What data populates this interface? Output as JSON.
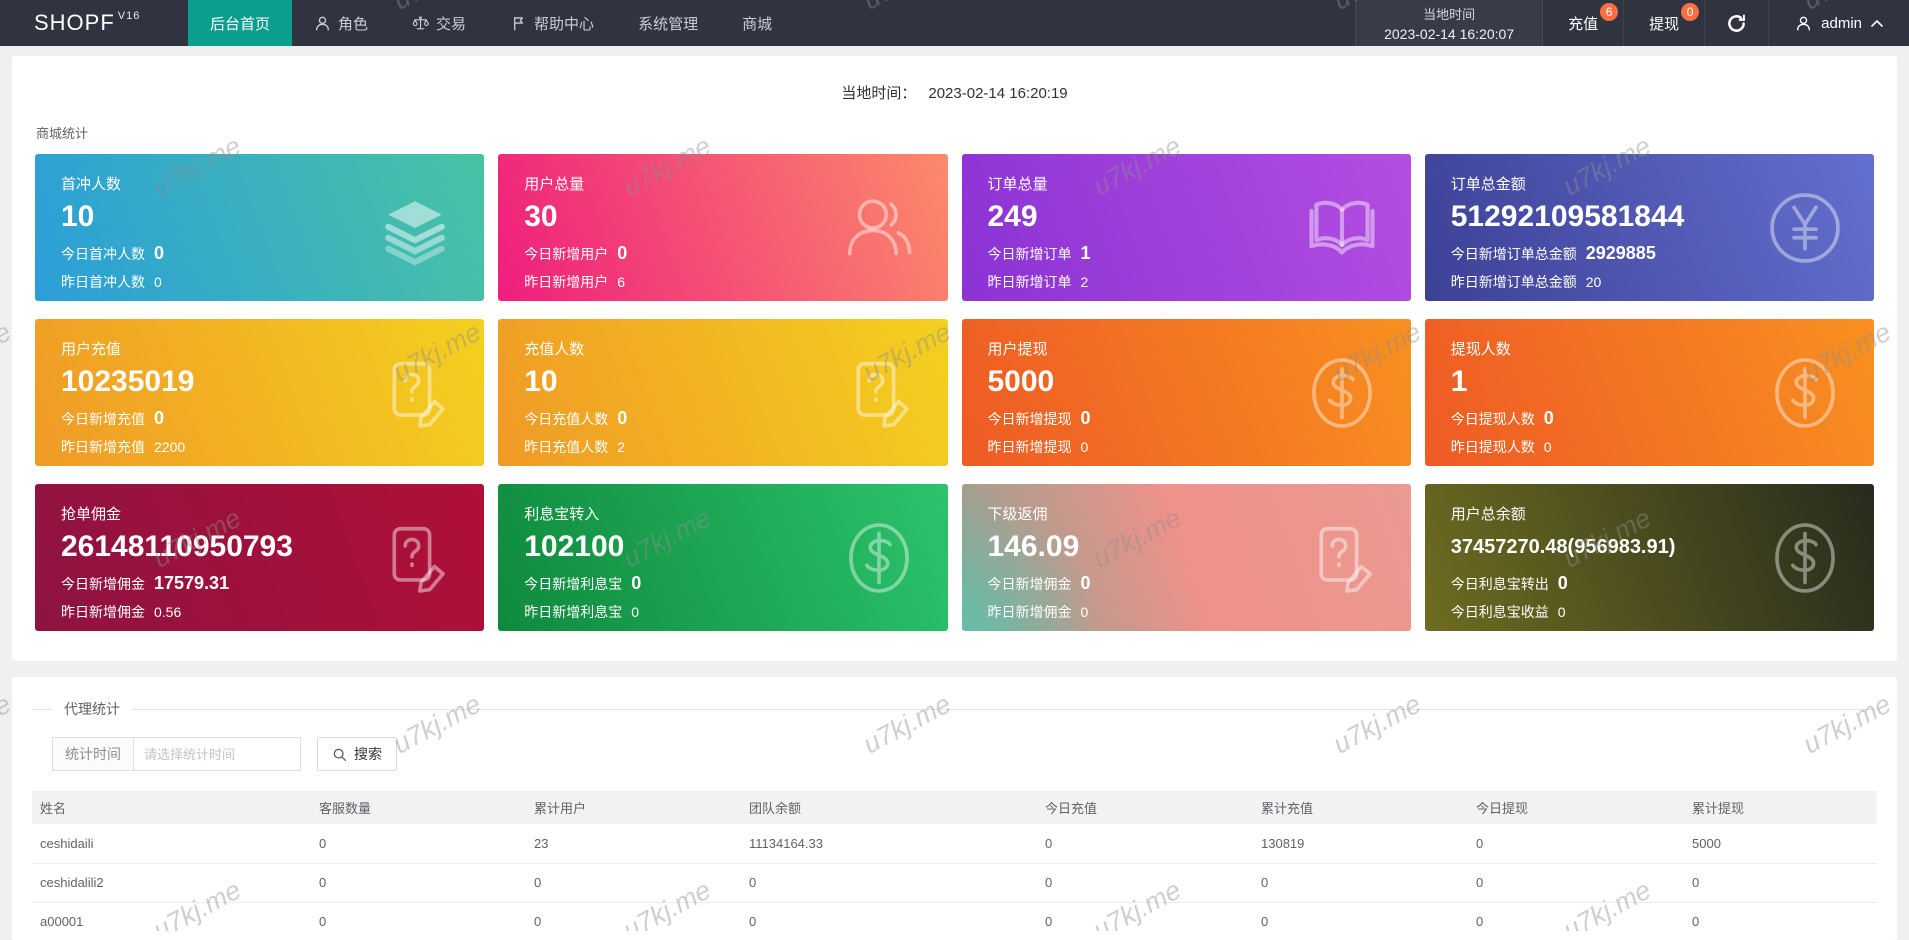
{
  "navbar": {
    "logo_text": "SHOPF",
    "logo_version": "V16",
    "menu": [
      {
        "id": "dashboard",
        "label": "后台首页",
        "active": true
      },
      {
        "id": "roles",
        "label": "角色",
        "icon": "user"
      },
      {
        "id": "trade",
        "label": "交易",
        "icon": "scales"
      },
      {
        "id": "help",
        "label": "帮助中心",
        "icon": "flag"
      },
      {
        "id": "system",
        "label": "系统管理"
      },
      {
        "id": "mall",
        "label": "商城"
      }
    ],
    "local_time_label": "当地时间",
    "local_time_value": "2023-02-14 16:20:07",
    "recharge": {
      "label": "充值",
      "badge": "6"
    },
    "withdraw": {
      "label": "提现",
      "badge": "0"
    },
    "user": "admin"
  },
  "main": {
    "time": {
      "label": "当地时间：",
      "value": "2023-02-14 16:20:19"
    },
    "stats_title": "商城统计",
    "cards": [
      {
        "id": "first-recharge-users",
        "title": "首冲人数",
        "value": "10",
        "line2_label": "今日首冲人数",
        "line2_value": "0",
        "line3_label": "昨日首冲人数",
        "line3_value": "0",
        "icon": "layers",
        "gradient": [
          "#2b9ed9",
          "#49c3a4"
        ]
      },
      {
        "id": "total-users",
        "title": "用户总量",
        "value": "30",
        "line2_label": "今日新增用户",
        "line2_value": "0",
        "line3_label": "昨日新增用户",
        "line3_value": "6",
        "icon": "users",
        "gradient": [
          "#ef1e7d",
          "#fb8a6b"
        ]
      },
      {
        "id": "total-orders",
        "title": "订单总量",
        "value": "249",
        "line2_label": "今日新增订单",
        "line2_value": "1",
        "line3_label": "昨日新增订单",
        "line3_value": "2",
        "icon": "book",
        "gradient": [
          "#8b33d4",
          "#b44ee2"
        ]
      },
      {
        "id": "order-amount",
        "title": "订单总金额",
        "value": "51292109581844",
        "line2_label": "今日新增订单总金额",
        "line2_value": "2929885",
        "line3_label": "昨日新增订单总金额",
        "line3_value": "20",
        "icon": "yen",
        "gradient": [
          "#3d4196",
          "#6470cf"
        ]
      },
      {
        "id": "user-recharge",
        "title": "用户充值",
        "value": "10235019",
        "line2_label": "今日新增充值",
        "line2_value": "0",
        "line3_label": "昨日新增充值",
        "line3_value": "2200",
        "icon": "doc",
        "gradient": [
          "#f09a26",
          "#f4d01f"
        ]
      },
      {
        "id": "recharge-users",
        "title": "充值人数",
        "value": "10",
        "line2_label": "今日充值人数",
        "line2_value": "0",
        "line3_label": "昨日充值人数",
        "line3_value": "2",
        "icon": "doc",
        "gradient": [
          "#f09a26",
          "#f4d01f"
        ]
      },
      {
        "id": "user-withdraw",
        "title": "用户提现",
        "value": "5000",
        "line2_label": "今日新增提现",
        "line2_value": "0",
        "line3_label": "昨日新增提现",
        "line3_value": "0",
        "icon": "dollar",
        "gradient": [
          "#ee5a25",
          "#f89020"
        ]
      },
      {
        "id": "withdraw-users",
        "title": "提现人数",
        "value": "1",
        "line2_label": "今日提现人数",
        "line2_value": "0",
        "line3_label": "昨日提现人数",
        "line3_value": "0",
        "icon": "dollar",
        "gradient": [
          "#ee5a25",
          "#f89020"
        ]
      },
      {
        "id": "order-commission",
        "title": "抢单佣金",
        "value": "26148110950793",
        "line2_label": "今日新增佣金",
        "line2_value": "17579.31",
        "line3_label": "昨日新增佣金",
        "line3_value": "0.56",
        "icon": "doc",
        "gradient": [
          "#8e1341",
          "#b00f36"
        ]
      },
      {
        "id": "interest-in",
        "title": "利息宝转入",
        "value": "102100",
        "line2_label": "今日新增利息宝",
        "line2_value": "0",
        "line3_label": "昨日新增利息宝",
        "line3_value": "0",
        "icon": "dollar",
        "gradient": [
          "#0f8a3d",
          "#2cc36c"
        ]
      },
      {
        "id": "sub-rebate",
        "title": "下级返佣",
        "value": "146.09",
        "line2_label": "今日新增佣金",
        "line2_value": "0",
        "line3_label": "昨日新增佣金",
        "line3_value": "0",
        "icon": "doc",
        "gradient": [
          "#90a28f",
          "#ee928a",
          "#eb9a91"
        ],
        "corner": "#5ec3ae"
      },
      {
        "id": "total-balance",
        "title": "用户总余额",
        "value": "37457270.48(956983.91)",
        "line2_label": "今日利息宝转出",
        "line2_value": "0",
        "line3_label": "今日利息宝收益",
        "line3_value": "0",
        "icon": "dollar",
        "gradient": [
          "#6e6c20",
          "#272b1d"
        ]
      }
    ],
    "agent": {
      "title": "代理统计",
      "filter_label": "统计时间",
      "filter_placeholder": "请选择统计时间",
      "search_label": "搜索",
      "table": {
        "headers": [
          "姓名",
          "客服数量",
          "累计用户",
          "团队余额",
          "今日充值",
          "累计充值",
          "今日提现",
          "累计提现"
        ],
        "rows": [
          [
            "ceshidaili",
            "0",
            "23",
            "11134164.33",
            "0",
            "130819",
            "0",
            "5000"
          ],
          [
            "ceshidalili2",
            "0",
            "0",
            "0",
            "0",
            "0",
            "0",
            "0"
          ],
          [
            "a00001",
            "0",
            "0",
            "0",
            "0",
            "0",
            "0",
            "0"
          ]
        ]
      }
    }
  },
  "watermark": {
    "text": "u7kj.me"
  },
  "colors": {
    "navbar_bg": "#2f3440",
    "accent": "#0a9e8e",
    "badge": "#fb6e3f",
    "page_bg": "#f0f0f0"
  }
}
